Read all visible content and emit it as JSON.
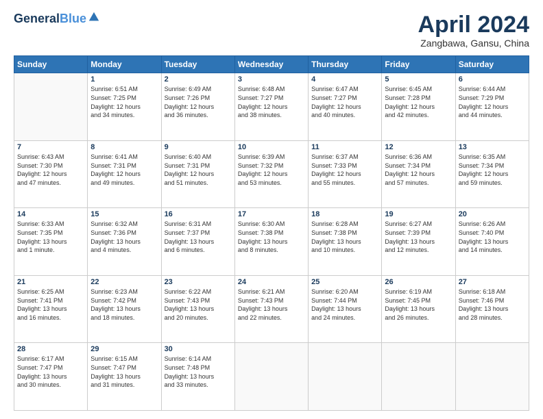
{
  "header": {
    "logo_line1": "General",
    "logo_line2": "Blue",
    "month": "April 2024",
    "location": "Zangbawa, Gansu, China"
  },
  "days_of_week": [
    "Sunday",
    "Monday",
    "Tuesday",
    "Wednesday",
    "Thursday",
    "Friday",
    "Saturday"
  ],
  "weeks": [
    [
      {
        "day": "",
        "info": ""
      },
      {
        "day": "1",
        "info": "Sunrise: 6:51 AM\nSunset: 7:25 PM\nDaylight: 12 hours\nand 34 minutes."
      },
      {
        "day": "2",
        "info": "Sunrise: 6:49 AM\nSunset: 7:26 PM\nDaylight: 12 hours\nand 36 minutes."
      },
      {
        "day": "3",
        "info": "Sunrise: 6:48 AM\nSunset: 7:27 PM\nDaylight: 12 hours\nand 38 minutes."
      },
      {
        "day": "4",
        "info": "Sunrise: 6:47 AM\nSunset: 7:27 PM\nDaylight: 12 hours\nand 40 minutes."
      },
      {
        "day": "5",
        "info": "Sunrise: 6:45 AM\nSunset: 7:28 PM\nDaylight: 12 hours\nand 42 minutes."
      },
      {
        "day": "6",
        "info": "Sunrise: 6:44 AM\nSunset: 7:29 PM\nDaylight: 12 hours\nand 44 minutes."
      }
    ],
    [
      {
        "day": "7",
        "info": "Sunrise: 6:43 AM\nSunset: 7:30 PM\nDaylight: 12 hours\nand 47 minutes."
      },
      {
        "day": "8",
        "info": "Sunrise: 6:41 AM\nSunset: 7:31 PM\nDaylight: 12 hours\nand 49 minutes."
      },
      {
        "day": "9",
        "info": "Sunrise: 6:40 AM\nSunset: 7:31 PM\nDaylight: 12 hours\nand 51 minutes."
      },
      {
        "day": "10",
        "info": "Sunrise: 6:39 AM\nSunset: 7:32 PM\nDaylight: 12 hours\nand 53 minutes."
      },
      {
        "day": "11",
        "info": "Sunrise: 6:37 AM\nSunset: 7:33 PM\nDaylight: 12 hours\nand 55 minutes."
      },
      {
        "day": "12",
        "info": "Sunrise: 6:36 AM\nSunset: 7:34 PM\nDaylight: 12 hours\nand 57 minutes."
      },
      {
        "day": "13",
        "info": "Sunrise: 6:35 AM\nSunset: 7:34 PM\nDaylight: 12 hours\nand 59 minutes."
      }
    ],
    [
      {
        "day": "14",
        "info": "Sunrise: 6:33 AM\nSunset: 7:35 PM\nDaylight: 13 hours\nand 1 minute."
      },
      {
        "day": "15",
        "info": "Sunrise: 6:32 AM\nSunset: 7:36 PM\nDaylight: 13 hours\nand 4 minutes."
      },
      {
        "day": "16",
        "info": "Sunrise: 6:31 AM\nSunset: 7:37 PM\nDaylight: 13 hours\nand 6 minutes."
      },
      {
        "day": "17",
        "info": "Sunrise: 6:30 AM\nSunset: 7:38 PM\nDaylight: 13 hours\nand 8 minutes."
      },
      {
        "day": "18",
        "info": "Sunrise: 6:28 AM\nSunset: 7:38 PM\nDaylight: 13 hours\nand 10 minutes."
      },
      {
        "day": "19",
        "info": "Sunrise: 6:27 AM\nSunset: 7:39 PM\nDaylight: 13 hours\nand 12 minutes."
      },
      {
        "day": "20",
        "info": "Sunrise: 6:26 AM\nSunset: 7:40 PM\nDaylight: 13 hours\nand 14 minutes."
      }
    ],
    [
      {
        "day": "21",
        "info": "Sunrise: 6:25 AM\nSunset: 7:41 PM\nDaylight: 13 hours\nand 16 minutes."
      },
      {
        "day": "22",
        "info": "Sunrise: 6:23 AM\nSunset: 7:42 PM\nDaylight: 13 hours\nand 18 minutes."
      },
      {
        "day": "23",
        "info": "Sunrise: 6:22 AM\nSunset: 7:43 PM\nDaylight: 13 hours\nand 20 minutes."
      },
      {
        "day": "24",
        "info": "Sunrise: 6:21 AM\nSunset: 7:43 PM\nDaylight: 13 hours\nand 22 minutes."
      },
      {
        "day": "25",
        "info": "Sunrise: 6:20 AM\nSunset: 7:44 PM\nDaylight: 13 hours\nand 24 minutes."
      },
      {
        "day": "26",
        "info": "Sunrise: 6:19 AM\nSunset: 7:45 PM\nDaylight: 13 hours\nand 26 minutes."
      },
      {
        "day": "27",
        "info": "Sunrise: 6:18 AM\nSunset: 7:46 PM\nDaylight: 13 hours\nand 28 minutes."
      }
    ],
    [
      {
        "day": "28",
        "info": "Sunrise: 6:17 AM\nSunset: 7:47 PM\nDaylight: 13 hours\nand 30 minutes."
      },
      {
        "day": "29",
        "info": "Sunrise: 6:15 AM\nSunset: 7:47 PM\nDaylight: 13 hours\nand 31 minutes."
      },
      {
        "day": "30",
        "info": "Sunrise: 6:14 AM\nSunset: 7:48 PM\nDaylight: 13 hours\nand 33 minutes."
      },
      {
        "day": "",
        "info": ""
      },
      {
        "day": "",
        "info": ""
      },
      {
        "day": "",
        "info": ""
      },
      {
        "day": "",
        "info": ""
      }
    ]
  ]
}
